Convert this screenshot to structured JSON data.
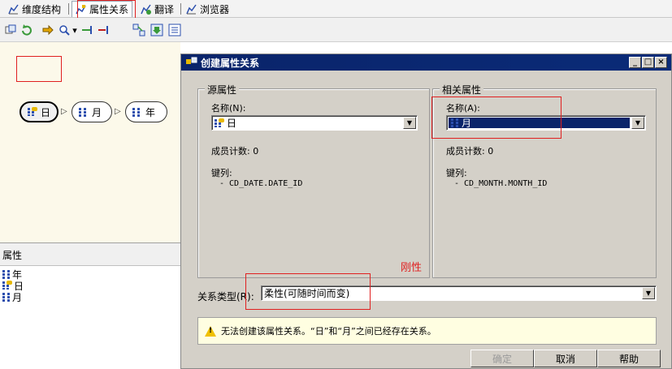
{
  "tabs": [
    {
      "label": "维度结构",
      "icon": "structure-icon"
    },
    {
      "label": "属性关系",
      "icon": "relationship-icon",
      "active": true
    },
    {
      "label": "翻译",
      "icon": "translation-icon"
    },
    {
      "label": "浏览器",
      "icon": "browser-icon"
    }
  ],
  "diagram": {
    "nodes": [
      {
        "label": "日",
        "icon": "key-attribute-icon",
        "selected": true
      },
      {
        "label": "月",
        "icon": "attribute-icon"
      },
      {
        "label": "年",
        "icon": "attribute-icon"
      }
    ]
  },
  "attributes_panel": {
    "title": "属性",
    "items": [
      {
        "label": "年",
        "icon": "attribute-icon"
      },
      {
        "label": "日",
        "icon": "key-attribute-icon"
      },
      {
        "label": "月",
        "icon": "attribute-icon"
      }
    ]
  },
  "dialog": {
    "title": "创建属性关系",
    "source": {
      "group_title": "源属性",
      "name_label": "名称(N):",
      "name_value": "日",
      "member_count": "成员计数: 0",
      "key_columns_label": "键列:",
      "key_column": "- CD_DATE.DATE_ID"
    },
    "related": {
      "group_title": "相关属性",
      "name_label": "名称(A):",
      "name_value": "月",
      "member_count": "成员计数: 0",
      "key_columns_label": "键列:",
      "key_column": "- CD_MONTH.MONTH_ID"
    },
    "rigid_annotation": "刚性",
    "relationship_type_label": "关系类型(R):",
    "relationship_type_value": "柔性(可随时间而变)",
    "warning": "无法创建该属性关系。“日”和“月”之间已经存在关系。",
    "buttons": {
      "ok": "确定",
      "cancel": "取消",
      "help": "帮助"
    }
  },
  "colors": {
    "titlebar": "#0a246a",
    "diagram_bg": "#fcf9ea",
    "highlight": "#e02020",
    "warning_bg": "#fffee1"
  }
}
